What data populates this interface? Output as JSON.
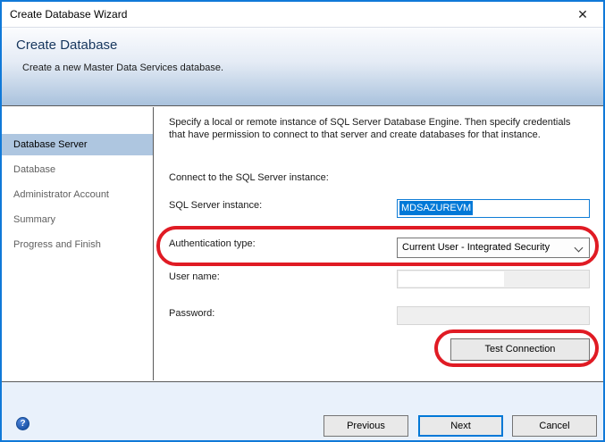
{
  "window": {
    "title": "Create Database Wizard",
    "close_glyph": "✕"
  },
  "header": {
    "title": "Create Database",
    "subtitle": "Create a new Master Data Services database."
  },
  "sidebar": {
    "items": [
      {
        "label": "Database Server",
        "selected": true
      },
      {
        "label": "Database",
        "selected": false
      },
      {
        "label": "Administrator Account",
        "selected": false
      },
      {
        "label": "Summary",
        "selected": false
      },
      {
        "label": "Progress and Finish",
        "selected": false
      }
    ]
  },
  "content": {
    "intro": "Specify a local or remote instance of SQL Server Database Engine. Then specify credentials that have permission to connect to that server and create databases for that instance.",
    "connect_label": "Connect to the SQL Server instance:",
    "fields": {
      "sql_instance": {
        "label": "SQL Server instance:",
        "value": "MDSAZUREVM",
        "state": "focused, text selected"
      },
      "auth_type": {
        "label": "Authentication type:",
        "value": "Current User - Integrated Security",
        "state": "enabled"
      },
      "user_name": {
        "label": "User name:",
        "value": "",
        "state": "disabled, value redacted"
      },
      "password": {
        "label": "Password:",
        "value": "",
        "state": "disabled"
      }
    },
    "test_connection_label": "Test Connection"
  },
  "annotations": {
    "note": "hand-drawn red ovals highlighting authentication type row and Test Connection button",
    "color": "#e01b24"
  },
  "footer": {
    "help_glyph": "?",
    "buttons": {
      "previous": "Previous",
      "next": "Next",
      "cancel": "Cancel"
    }
  },
  "colors": {
    "dialog_border": "#1079d8",
    "header_gradient_bottom": "#a9c2dd",
    "sidebar_selected_bg": "#aec6e0",
    "selection_highlight": "#0078d7",
    "footer_bg": "#e9f1fb",
    "annotation_red": "#e01b24"
  }
}
